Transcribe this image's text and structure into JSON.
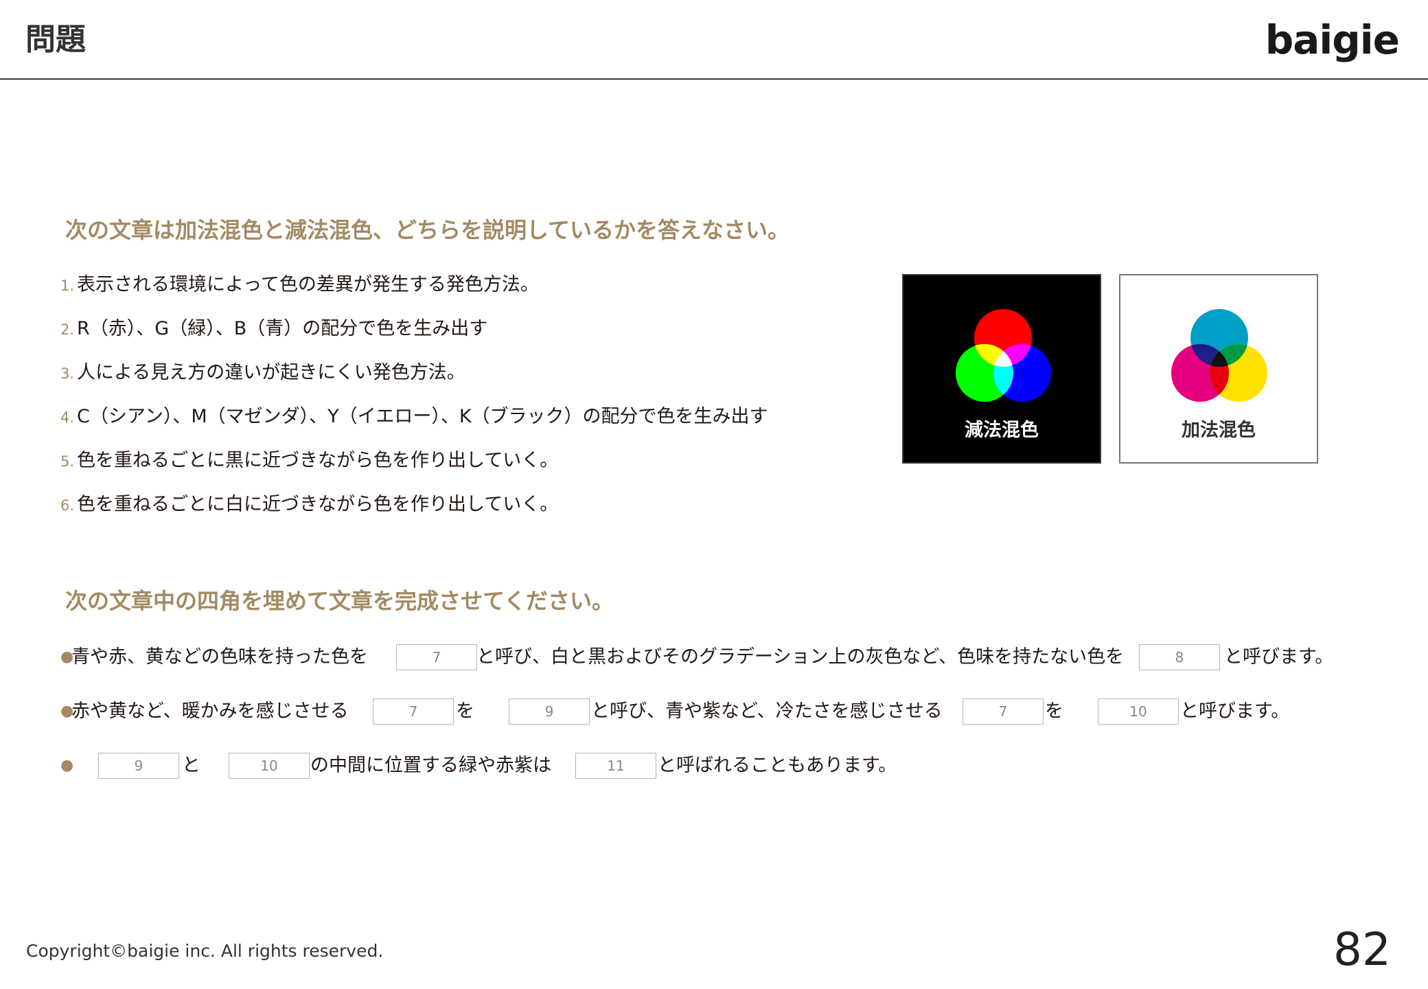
{
  "header": {
    "title": "問題",
    "logo": "baigie"
  },
  "section1": {
    "heading": "次の文章は加法混色と減法混色、どちらを説明しているかを答えなさい。",
    "items": [
      {
        "num": "1.",
        "text": "表示される環境によって色の差異が発生する発色方法。"
      },
      {
        "num": "2.",
        "text": "R（赤）、G（緑）、B（青）の配分で色を生み出す"
      },
      {
        "num": "3.",
        "text": "人による見え方の違いが起きにくい発色方法。"
      },
      {
        "num": "4.",
        "text": "C（シアン）、M（マゼンダ）、Y（イエロー）、K（ブラック）の配分で色を生み出す"
      },
      {
        "num": "5.",
        "text": "色を重ねるごとに黒に近づきながら色を作り出していく。"
      },
      {
        "num": "6.",
        "text": "色を重ねるごとに白に近づきながら色を作り出していく。"
      }
    ]
  },
  "figures": {
    "dark_label": "減法混色",
    "light_label": "加法混色"
  },
  "section2": {
    "heading": "次の文章中の四角を埋めて文章を完成させてください。",
    "bullet": "●",
    "line1": {
      "t1": "青や赤、黄などの色味を持った色を",
      "b1": "7",
      "t2": "と呼び、白と黒およびそのグラデーション上の灰色など、色味を持たない色を",
      "b2": "8",
      "t3": "と呼びます。"
    },
    "line2": {
      "t1": "赤や黄など、暖かみを感じさせる",
      "b1": "7",
      "t2": "を",
      "b2": "9",
      "t3": "と呼び、青や紫など、冷たさを感じさせる",
      "b3": "7",
      "t4": "を",
      "b4": "10",
      "t5": "と呼びます。"
    },
    "line3": {
      "b1": "9",
      "t1": "と",
      "b2": "10",
      "t2": "の中間に位置する緑や赤紫は",
      "b3": "11",
      "t3": "と呼ばれることもあります。"
    }
  },
  "footer": {
    "copyright": "Copyright©baigie inc. All rights reserved.",
    "page_number": "82"
  }
}
